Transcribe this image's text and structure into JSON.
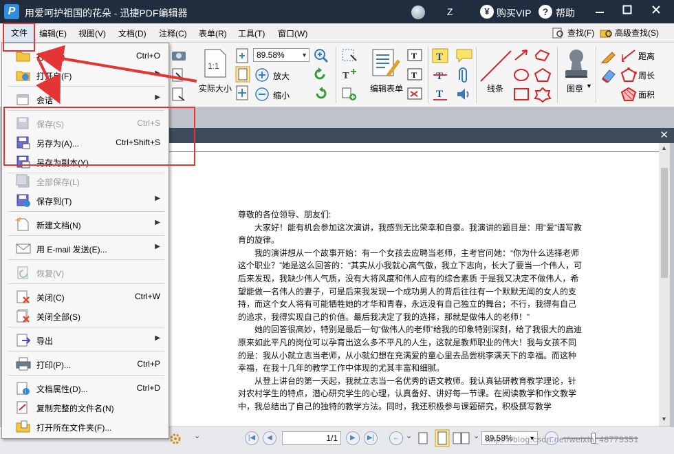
{
  "window": {
    "title": "用爱呵护祖国的花朵 - 迅捷PDF编辑器",
    "logo_letter": "P",
    "user_initial": "Z",
    "vip_label": "购买VIP",
    "vip_symbol": "¥",
    "help_label": "帮助",
    "help_symbol": "?"
  },
  "menubar": {
    "items": [
      "文件",
      "编辑(E)",
      "视图(V)",
      "文档(D)",
      "注释(C)",
      "表单(R)",
      "工具(T)",
      "窗口(W)"
    ],
    "find_label": "查找(F)",
    "advanced_find_label": "高级查找(S)"
  },
  "toolbar": {
    "actual_size_label": "实际大小",
    "fit_icon_text": "1:1",
    "zoom_value": "89.58%",
    "zoom_in_label": "放大",
    "zoom_out_label": "缩小",
    "edit_form_label": "编辑表单",
    "line_label": "线条",
    "stamp_label": "图章",
    "distance_label": "距离",
    "perimeter_label": "周长",
    "area_label": "面积"
  },
  "file_menu": {
    "items": [
      {
        "label": "打开(O)...",
        "shortcut": "Ctrl+O",
        "submenu": false,
        "disabled": false,
        "icon": "open-folder-icon"
      },
      {
        "label": "打开自(F)",
        "shortcut": "",
        "submenu": true,
        "disabled": false,
        "icon": "open-from-icon"
      },
      {
        "label": "会话",
        "shortcut": "",
        "submenu": true,
        "disabled": false,
        "icon": "session-icon"
      },
      {
        "label": "保存(S)",
        "shortcut": "Ctrl+S",
        "submenu": false,
        "disabled": true,
        "icon": "save-icon"
      },
      {
        "label": "另存为(A)...",
        "shortcut": "Ctrl+Shift+S",
        "submenu": false,
        "disabled": false,
        "icon": "save-as-icon"
      },
      {
        "label": "另存为副本(Y)...",
        "shortcut": "",
        "submenu": false,
        "disabled": false,
        "icon": "save-copy-icon"
      },
      {
        "label": "全部保存(L)",
        "shortcut": "",
        "submenu": false,
        "disabled": true,
        "icon": "save-all-icon"
      },
      {
        "label": "保存到(T)",
        "shortcut": "",
        "submenu": true,
        "disabled": false,
        "icon": "save-to-icon"
      },
      {
        "label": "新建文档(N)",
        "shortcut": "",
        "submenu": true,
        "disabled": false,
        "icon": "new-document-icon"
      },
      {
        "label": "用 E-mail 发送(E)...",
        "shortcut": "",
        "submenu": true,
        "disabled": false,
        "icon": "email-icon"
      },
      {
        "label": "恢复(V)",
        "shortcut": "",
        "submenu": false,
        "disabled": true,
        "icon": "revert-icon"
      },
      {
        "label": "关闭(C)",
        "shortcut": "Ctrl+W",
        "submenu": false,
        "disabled": false,
        "icon": "close-doc-icon"
      },
      {
        "label": "关闭全部(S)",
        "shortcut": "",
        "submenu": false,
        "disabled": false,
        "icon": "close-all-icon"
      },
      {
        "label": "导出",
        "shortcut": "",
        "submenu": true,
        "disabled": false,
        "icon": "export-icon"
      },
      {
        "label": "打印(P)...",
        "shortcut": "Ctrl+P",
        "submenu": false,
        "disabled": false,
        "icon": "print-icon"
      },
      {
        "label": "文档属性(D)...",
        "shortcut": "Ctrl+D",
        "submenu": false,
        "disabled": false,
        "icon": "properties-icon"
      },
      {
        "label": "复制完整的文件名(N)",
        "shortcut": "",
        "submenu": false,
        "disabled": false,
        "icon": "copy-filename-icon"
      },
      {
        "label": "打开所在文件夹(F)...",
        "shortcut": "",
        "submenu": false,
        "disabled": false,
        "icon": "open-containing-folder-icon"
      }
    ]
  },
  "document": {
    "paragraphs": [
      {
        "indent": false,
        "text": "尊敬的各位领导、朋友们:"
      },
      {
        "indent": true,
        "text": "大家好！能有机会参加这次演讲，我感到无比荣幸和自豪。我演讲的题目是：用“爱”谱写教育的旋律。"
      },
      {
        "indent": true,
        "text": "我的演讲想从一个故事开始：有一个女孩去应聘当老师，主考官问她：“你为什么选择老师这个职业？”她是这么回答的：“其实从小我就心高气傲，我立下志向，长大了要当一个伟人，可后来发现，我缺少伟人气质，没有大将风度和伟人应有的综合素质 于是我又决定不做伟人，希望能做一名伟人的妻子，可是后来我发现一个成功男人的背后往往有一个默默无闻的女人的支持，而这个女人将有可能牺牲她的才华和青春，永远没有自己独立的舞台；不行，我得有自己的追求，我得实现自己的价值。最后我决定了我的选择，那就是做伟人的老师！”"
      },
      {
        "indent": true,
        "text": "她的回答很高妙，特别是最后一句“做伟人的老师”给我的印象特别深刻，给了我很大的启迪 原来如此平凡的岗位可以孕育出这么多不平凡的人生，这就是教师职业的伟大！我与女孩不同的是：我从小就立志当老师，从小就幻想在充满爱的童心里去品尝桃李满天下的幸福。而这种幸福，在我十几年的教学工作中体现的尤其丰富和细腻。"
      },
      {
        "indent": true,
        "text": "从登上讲台的第一天起，我就立志当一名优秀的语文教师。我认真钻研教育教学理论，针对农村学生的特点，潜心研究学生的心理，认真备好、讲好每一节课。在阅读教学和作文教学中，我总结出了自己的独特的教学方法。同时，我还积极参与课题研究，积极撰写教学"
      }
    ]
  },
  "statusbar": {
    "page_value": "1/1",
    "zoom_value": "89.58%",
    "watermark": "https://blog.csdn.net/weixin_48779351"
  },
  "colors": {
    "titlebar": "#1f2d3f",
    "annotation_red": "#e53434",
    "menu_bg": "#f7f7f7",
    "disabled_text": "#9a9a9a"
  }
}
